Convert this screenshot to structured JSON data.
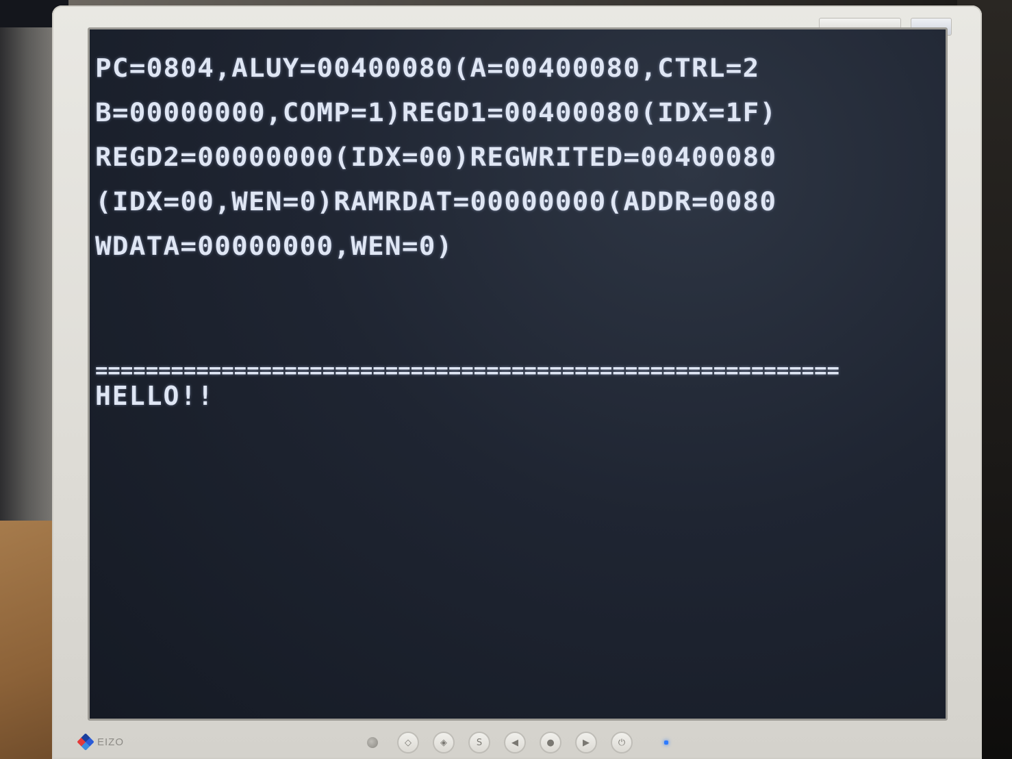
{
  "terminal": {
    "debug_lines": [
      "PC=0804,ALUY=00400080(A=00400080,CTRL=2",
      "B=00000000,COMP=1)REGD1=00400080(IDX=1F)",
      "REGD2=00000000(IDX=00)REGWRITED=00400080",
      "(IDX=00,WEN=0)RAMRDAT=00000000(ADDR=0080",
      "WDATA=00000000,WEN=0)"
    ],
    "separator": "===========================================================",
    "message": "HELLO!!"
  },
  "monitor": {
    "brand": "EIZO",
    "controls": [
      "mode",
      "volume-down",
      "volume-up",
      "S",
      "left",
      "enter",
      "right",
      "power"
    ]
  }
}
